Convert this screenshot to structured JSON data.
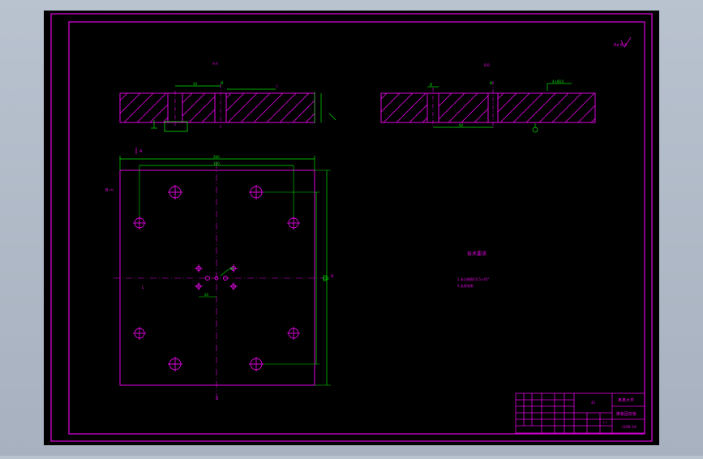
{
  "drawing": {
    "section_label_left": "A-A",
    "section_label_right": "B-B",
    "roughness_symbol": "Ra 6.3",
    "dim_overall_width": "200",
    "dim_inner_width": "160",
    "dim_hole_label": "Ø6",
    "dim_center_offset": "20",
    "dim_side_height": "200",
    "dim_right_view_label": "4×Ø10",
    "cut_mark": "A",
    "tech_req_title": "技术要求",
    "tech_req_lines": [
      "1.未注倒角C0.5×45°",
      "2.去除毛刺"
    ],
    "title_block": {
      "school": "某某大学",
      "part_name": "推板固定板",
      "drawing_no": "CDM-16",
      "scale": "1:1",
      "material": "45"
    }
  }
}
